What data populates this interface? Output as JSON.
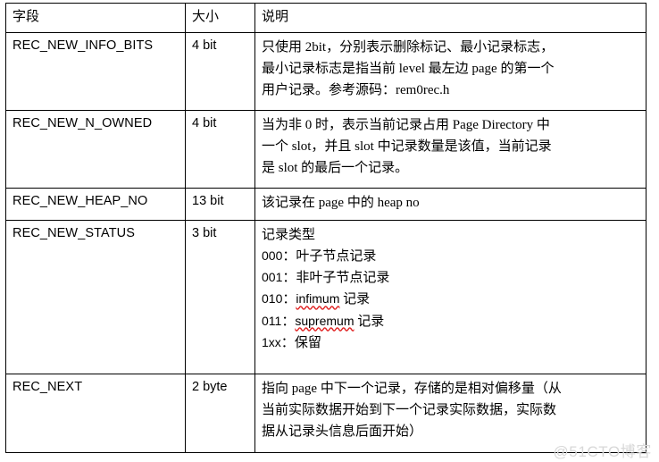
{
  "table": {
    "headers": {
      "field": "字段",
      "size": "大小",
      "description": "说明"
    },
    "rows": [
      {
        "field": "REC_NEW_INFO_BITS",
        "size": "4 bit",
        "desc_lines": [
          "只使用 2bit，分别表示删除标记、最小记录标志，",
          "最小记录标志是指当前 level 最左边 page 的第一个",
          "用户记录。参考源码：rem0rec.h"
        ]
      },
      {
        "field": "REC_NEW_N_OWNED",
        "size": "4 bit",
        "desc_lines": [
          "当为非 0 时，表示当前记录占用 Page Directory 中",
          "一个 slot，并且 slot 中记录数量是该值，当前记录",
          "是 slot 的最后一个记录。"
        ]
      },
      {
        "field": "REC_NEW_HEAP_NO",
        "size": "13 bit",
        "desc_lines": [
          "该记录在 page 中的 heap no"
        ]
      },
      {
        "field": "REC_NEW_STATUS",
        "size": "3 bit",
        "desc_title": "记录类型",
        "status_options": [
          {
            "code": "000",
            "sep": "：",
            "label": "叶子节点记录",
            "misspelled": ""
          },
          {
            "code": "001",
            "sep": "：",
            "label": "非叶子节点记录",
            "misspelled": ""
          },
          {
            "code": "010",
            "sep": "：",
            "label": " 记录",
            "misspelled": "infimum"
          },
          {
            "code": "011",
            "sep": "：",
            "label": " 记录",
            "misspelled": "supremum"
          },
          {
            "code": "1xx",
            "sep": "：",
            "label": "保留",
            "misspelled": ""
          }
        ]
      },
      {
        "field": "REC_NEXT",
        "size": "2 byte",
        "desc_lines": [
          "指向 page 中下一个记录，存储的是相对偏移量（从",
          "当前实际数据开始到下一个记录实际数据，实际数",
          "据从记录头信息后面开始）"
        ]
      }
    ]
  },
  "watermark": {
    "text": "@51CTO博客",
    "color": "#d8d8d8"
  },
  "theme": {
    "border_color": "#000000",
    "text_color": "#000000",
    "background": "#ffffff",
    "spellcheck_underline": "#e02020"
  }
}
